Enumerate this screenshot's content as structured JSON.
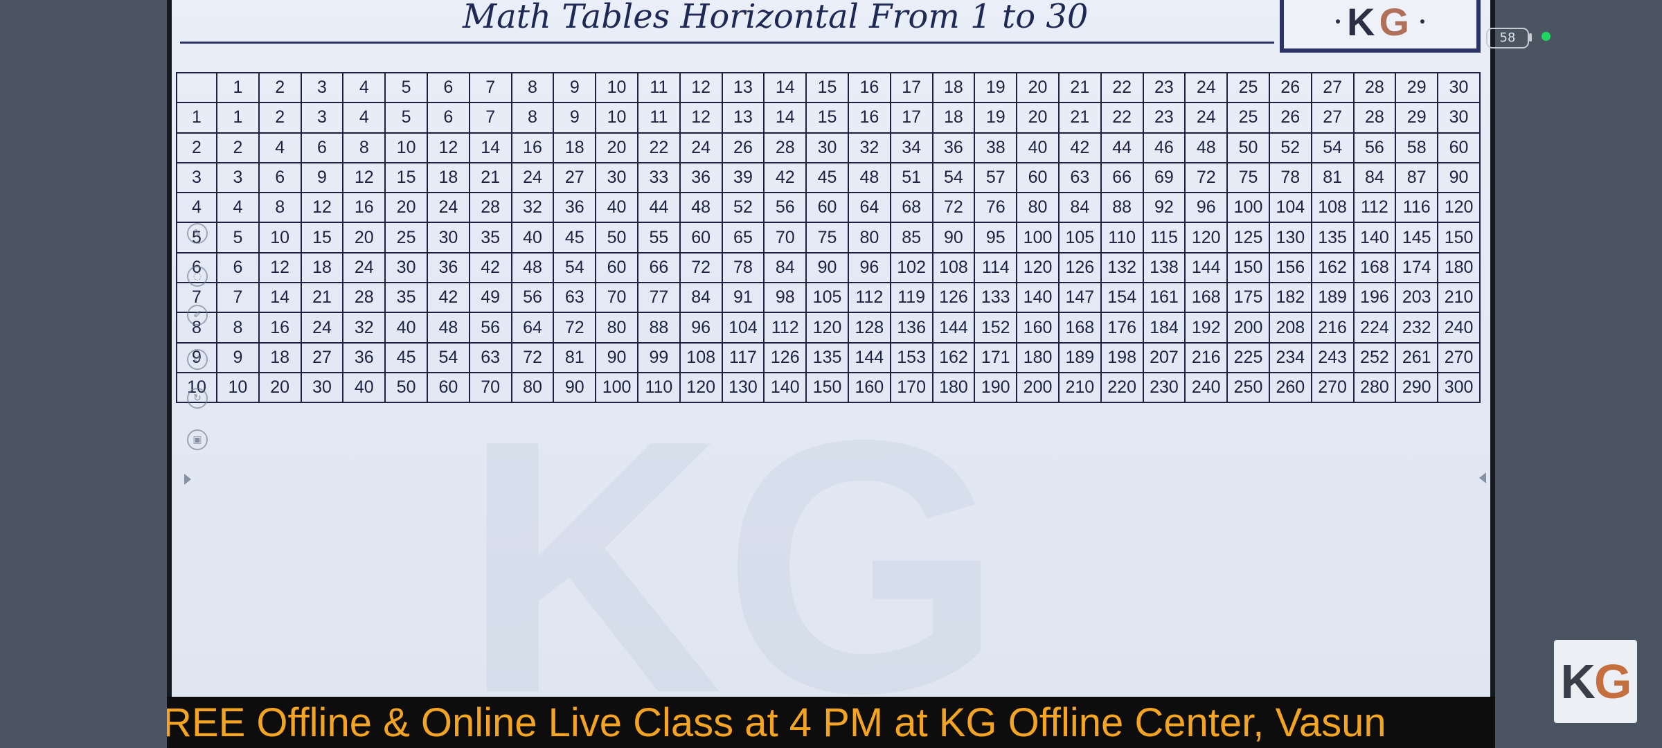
{
  "title": "Math Tables Horizontal From 1 to 30",
  "logo": {
    "k": "K",
    "g": "G"
  },
  "table": {
    "header": [
      "",
      "1",
      "2",
      "3",
      "4",
      "5",
      "6",
      "7",
      "8",
      "9",
      "10",
      "11",
      "12",
      "13",
      "14",
      "15",
      "16",
      "17",
      "18",
      "19",
      "20",
      "21",
      "22",
      "23",
      "24",
      "25",
      "26",
      "27",
      "28",
      "29",
      "30"
    ],
    "rows": [
      [
        "1",
        "1",
        "2",
        "3",
        "4",
        "5",
        "6",
        "7",
        "8",
        "9",
        "10",
        "11",
        "12",
        "13",
        "14",
        "15",
        "16",
        "17",
        "18",
        "19",
        "20",
        "21",
        "22",
        "23",
        "24",
        "25",
        "26",
        "27",
        "28",
        "29",
        "30"
      ],
      [
        "2",
        "2",
        "4",
        "6",
        "8",
        "10",
        "12",
        "14",
        "16",
        "18",
        "20",
        "22",
        "24",
        "26",
        "28",
        "30",
        "32",
        "34",
        "36",
        "38",
        "40",
        "42",
        "44",
        "46",
        "48",
        "50",
        "52",
        "54",
        "56",
        "58",
        "60"
      ],
      [
        "3",
        "3",
        "6",
        "9",
        "12",
        "15",
        "18",
        "21",
        "24",
        "27",
        "30",
        "33",
        "36",
        "39",
        "42",
        "45",
        "48",
        "51",
        "54",
        "57",
        "60",
        "63",
        "66",
        "69",
        "72",
        "75",
        "78",
        "81",
        "84",
        "87",
        "90"
      ],
      [
        "4",
        "4",
        "8",
        "12",
        "16",
        "20",
        "24",
        "28",
        "32",
        "36",
        "40",
        "44",
        "48",
        "52",
        "56",
        "60",
        "64",
        "68",
        "72",
        "76",
        "80",
        "84",
        "88",
        "92",
        "96",
        "100",
        "104",
        "108",
        "112",
        "116",
        "120"
      ],
      [
        "5",
        "5",
        "10",
        "15",
        "20",
        "25",
        "30",
        "35",
        "40",
        "45",
        "50",
        "55",
        "60",
        "65",
        "70",
        "75",
        "80",
        "85",
        "90",
        "95",
        "100",
        "105",
        "110",
        "115",
        "120",
        "125",
        "130",
        "135",
        "140",
        "145",
        "150"
      ],
      [
        "6",
        "6",
        "12",
        "18",
        "24",
        "30",
        "36",
        "42",
        "48",
        "54",
        "60",
        "66",
        "72",
        "78",
        "84",
        "90",
        "96",
        "102",
        "108",
        "114",
        "120",
        "126",
        "132",
        "138",
        "144",
        "150",
        "156",
        "162",
        "168",
        "174",
        "180"
      ],
      [
        "7",
        "7",
        "14",
        "21",
        "28",
        "35",
        "42",
        "49",
        "56",
        "63",
        "70",
        "77",
        "84",
        "91",
        "98",
        "105",
        "112",
        "119",
        "126",
        "133",
        "140",
        "147",
        "154",
        "161",
        "168",
        "175",
        "182",
        "189",
        "196",
        "203",
        "210"
      ],
      [
        "8",
        "8",
        "16",
        "24",
        "32",
        "40",
        "48",
        "56",
        "64",
        "72",
        "80",
        "88",
        "96",
        "104",
        "112",
        "120",
        "128",
        "136",
        "144",
        "152",
        "160",
        "168",
        "176",
        "184",
        "192",
        "200",
        "208",
        "216",
        "224",
        "232",
        "240"
      ],
      [
        "9",
        "9",
        "18",
        "27",
        "36",
        "45",
        "54",
        "63",
        "72",
        "81",
        "90",
        "99",
        "108",
        "117",
        "126",
        "135",
        "144",
        "153",
        "162",
        "171",
        "180",
        "189",
        "198",
        "207",
        "216",
        "225",
        "234",
        "243",
        "252",
        "261",
        "270"
      ],
      [
        "10",
        "10",
        "20",
        "30",
        "40",
        "50",
        "60",
        "70",
        "80",
        "90",
        "100",
        "110",
        "120",
        "130",
        "140",
        "150",
        "160",
        "170",
        "180",
        "190",
        "200",
        "210",
        "220",
        "230",
        "240",
        "250",
        "260",
        "270",
        "280",
        "290",
        "300"
      ]
    ]
  },
  "ticker": "REE Offline & Online Live Class at 4 PM at KG Offline Center, Vasun",
  "battery": "58",
  "corner_logo": {
    "k": "K",
    "g": "G"
  },
  "colors": {
    "ticker_text": "#f3a423",
    "table_border": "#1c2240",
    "rec_dot": "#1ed760"
  }
}
